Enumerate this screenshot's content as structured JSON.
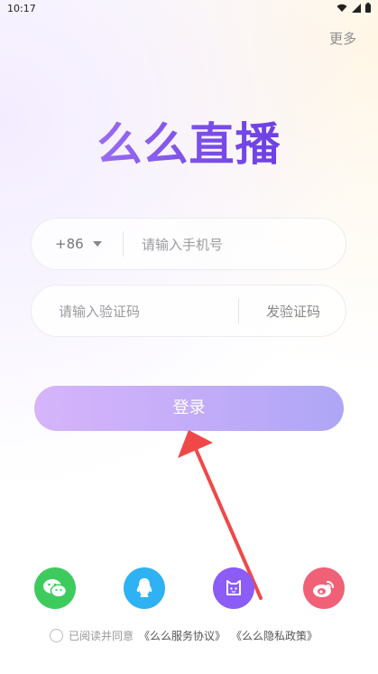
{
  "status_bar": {
    "time": "10:17"
  },
  "header": {
    "more_label": "更多"
  },
  "logo": {
    "text": "么么直播"
  },
  "phone": {
    "country_code": "+86",
    "placeholder": "请输入手机号"
  },
  "verify": {
    "placeholder": "请输入验证码",
    "send_label": "发验证码"
  },
  "login": {
    "label": "登录"
  },
  "social": [
    {
      "name": "wechat",
      "icon": "wechat-icon",
      "color": "#3ecb5e"
    },
    {
      "name": "qq",
      "icon": "qq-icon",
      "color": "#2eb2f4"
    },
    {
      "name": "bilibili",
      "icon": "tv-mascot-icon",
      "color": "#8b5cf6"
    },
    {
      "name": "weibo",
      "icon": "weibo-icon",
      "color": "#f06177"
    }
  ],
  "agreement": {
    "prefix": "已阅读并同意",
    "service": "《么么服务协议》",
    "privacy": "《么么隐私政策》"
  },
  "colors": {
    "brand": "#7b4fe8",
    "button_start": "#d6b4fb",
    "button_end": "#aea6f6",
    "arrow": "#f04848"
  }
}
